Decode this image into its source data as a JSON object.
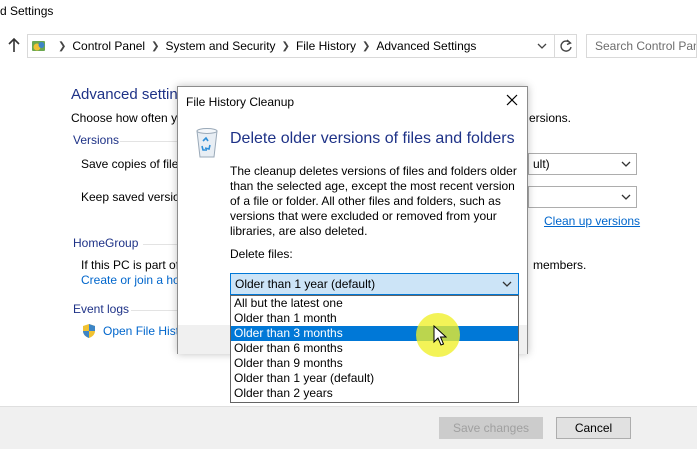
{
  "window": {
    "title": "d Settings"
  },
  "address_bar": {
    "crumbs": [
      "Control Panel",
      "System and Security",
      "File History",
      "Advanced Settings"
    ],
    "search_placeholder": "Search Control Panel"
  },
  "background": {
    "heading": "Advanced settin",
    "intro": "Choose how often y",
    "intro_tail": "ersions.",
    "versions_label": "Versions",
    "save_copies_label": "Save copies of files",
    "save_copies_value": "ult)",
    "keep_versions_label": "Keep saved version",
    "clean_up_link": "Clean up versions",
    "homegroup_label": "HomeGroup",
    "homegroup_text": "If this PC is part of",
    "homegroup_tail": "members.",
    "homegroup_link": "Create or join a ho",
    "event_logs_label": "Event logs",
    "event_logs_link": "Open File Hist"
  },
  "footer": {
    "save_label": "Save changes",
    "cancel_label": "Cancel"
  },
  "dialog": {
    "title": "File History Cleanup",
    "heading": "Delete older versions of files and folders",
    "body_lines": [
      "The cleanup deletes versions of files and folders older",
      "than the selected age, except the most recent version",
      "of a file or folder. All other files and folders, such as",
      "versions that were excluded or removed from your",
      "libraries, are also deleted."
    ],
    "delete_files_label": "Delete files:",
    "selected_value": "Older than 1 year (default)",
    "options": [
      "All but the latest one",
      "Older than 1 month",
      "Older than 3 months",
      "Older than 6 months",
      "Older than 9 months",
      "Older than 1 year (default)",
      "Older than 2 years"
    ],
    "highlighted_option": "Older than 3 months"
  },
  "colors": {
    "heading_blue": "#1e3287",
    "link_blue": "#0066cc",
    "selection_blue": "#0078d7",
    "cursor_halo": "#f0f028"
  }
}
